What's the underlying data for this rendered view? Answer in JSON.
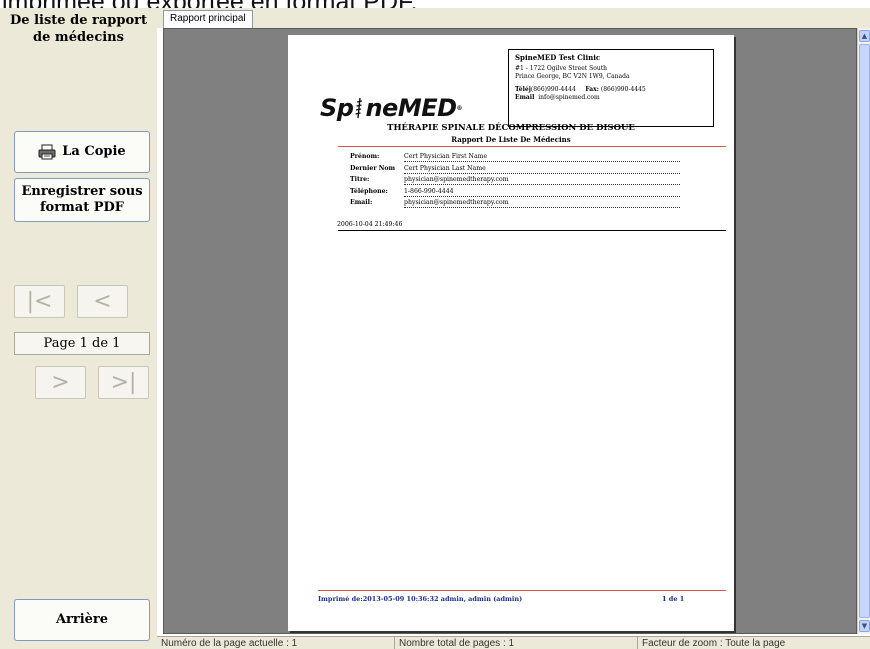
{
  "caption": "imprimée ou exportée en format PDF.",
  "sidebar": {
    "title": "De liste de rapport de médecins",
    "copy_button": "La Copie",
    "copy_icon": "printer-icon",
    "pdf_button": "Enregistrer sous format PDF",
    "back_button": "Arrière",
    "nav": {
      "first": "|<",
      "prev": "<",
      "next": ">",
      "last": ">|"
    },
    "page_indicator": "Page 1 de 1"
  },
  "tabs": [
    "Rapport principal"
  ],
  "report": {
    "clinic": {
      "name": "SpineMED Test Clinic",
      "address1": "#1 - 1722 Ogilve Street South",
      "address2": "Prince George, BC V2N 1W9, Canada",
      "tel_label": "Téléj",
      "tel": "(866)990-4444",
      "fax_label": "Fax:",
      "fax": "(866)990-4445",
      "email_label": "Email",
      "email": "info@spinemed.com"
    },
    "logo_left": "Sp",
    "logo_right": "neMED",
    "logo_tm": "®",
    "title": "THÉRAPIE SPINALE DÉCOMPRESSION DE DISOUE",
    "subtitle": "Rapport De Liste De Médecins",
    "fields": [
      {
        "label": "Prénom:",
        "value": "Cert Physician First Name"
      },
      {
        "label": "Dernier Nom",
        "value": "Cert Physician Last Name"
      },
      {
        "label": "Titre:",
        "value": "physician@spinemedtherapy.com"
      },
      {
        "label": "Téléphone:",
        "value": "1-866-990-4444"
      },
      {
        "label": "Email:",
        "value": "physician@spinemedtherapy.com"
      }
    ],
    "timestamp": "2006-10-04 21:49:46",
    "footer_printed": "Imprimé de:2013-05-09 10:36:32  admin, admin (admin)",
    "footer_page": "1 de 1"
  },
  "status": {
    "current_page": "Numéro de la page actuelle : 1",
    "total_pages": "Nombre total de pages : 1",
    "zoom": "Facteur de zoom : Toute la page"
  },
  "colors": {
    "panel": "#ece9d8",
    "viewer_bg": "#808080",
    "accent_rule": "#d9534f",
    "footer_text": "#1a2e8a"
  }
}
